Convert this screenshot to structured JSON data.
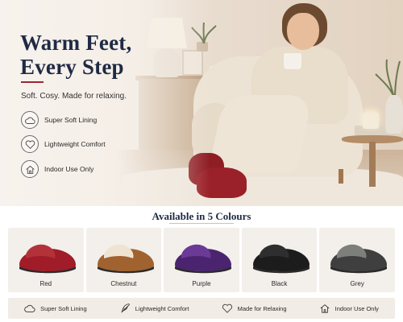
{
  "hero": {
    "headline_line1": "Warm Feet,",
    "headline_line2": "Every Step",
    "tagline": "Soft. Cosy. Made for relaxing.",
    "features": [
      {
        "icon": "cloud-icon",
        "label": "Super Soft Lining"
      },
      {
        "icon": "heart-icon",
        "label": "Lightweight Comfort"
      },
      {
        "icon": "house-icon",
        "label": "Indoor Use Only"
      }
    ],
    "accent_color": "#9b2730",
    "heading_color": "#1f2a44"
  },
  "colours": {
    "title": "Available in 5 Colours",
    "items": [
      {
        "name": "Red",
        "color": "#a01c28",
        "fur": "#b3323a"
      },
      {
        "name": "Chestnut",
        "color": "#a0622f",
        "fur": "#efe4d2"
      },
      {
        "name": "Purple",
        "color": "#4b2470",
        "fur": "#6a3a96"
      },
      {
        "name": "Black",
        "color": "#1c1c1c",
        "fur": "#2e2e2e"
      },
      {
        "name": "Grey",
        "color": "#3f3f3f",
        "fur": "#7d7f7a"
      }
    ]
  },
  "benefits_bar": [
    {
      "icon": "cloud-icon",
      "label": "Super Soft Lining"
    },
    {
      "icon": "feather-icon",
      "label": "Lightweight Comfort"
    },
    {
      "icon": "heart-icon",
      "label": "Made for Relaxing"
    },
    {
      "icon": "house-icon",
      "label": "Indoor Use Only"
    }
  ]
}
